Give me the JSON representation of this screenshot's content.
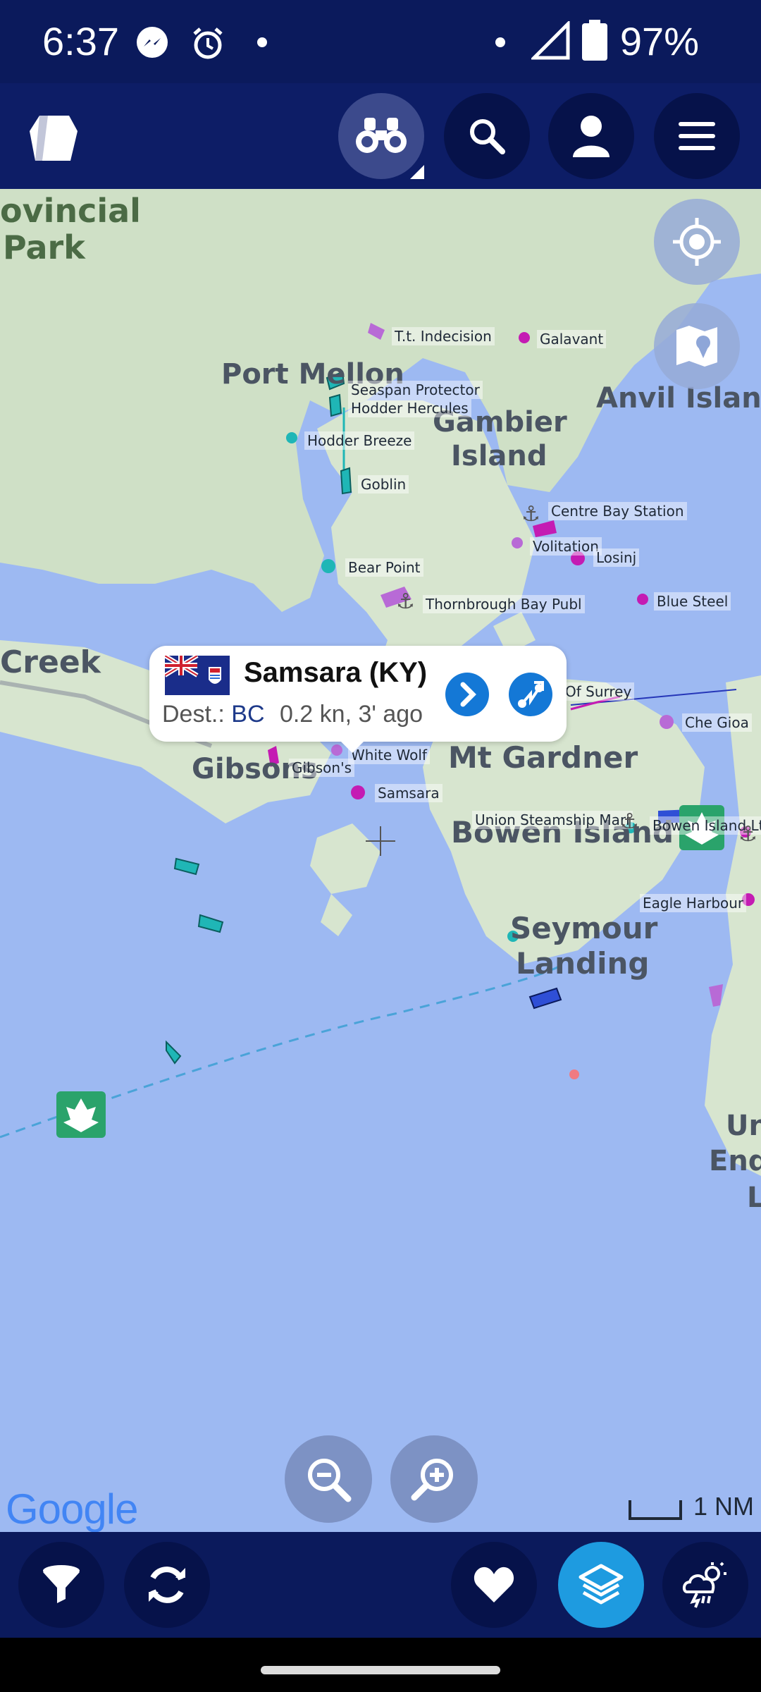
{
  "status": {
    "time": "6:37",
    "battery": "97%"
  },
  "popup": {
    "name": "Samsara (KY)",
    "dest_label": "Dest.:",
    "dest_value": "BC",
    "info": "0.2 kn, 3' ago"
  },
  "map": {
    "places": {
      "provincial": "ovincial",
      "park": "Park",
      "port_mellon": "Port Mellon",
      "gambier1": "Gambier",
      "gambier2": "Island",
      "anvil": "Anvil Island",
      "creek": "Creek",
      "gibsons": "Gibsons",
      "mt_gardner": "Mt Gardner",
      "bowen": "Bowen Island",
      "seymour1": "Seymour",
      "seymour2": "Landing",
      "un": "Un",
      "end": "End",
      "l": "L"
    },
    "vessels": [
      "T.t. Indecision",
      "Galavant",
      "Seaspan Protector",
      "Hodder Hercules",
      "Hodder Breeze",
      "Goblin",
      "Centre Bay Station",
      "Volitation",
      "Losinj",
      "Bear Point",
      "Thornbrough Bay Publ",
      "Blue Steel",
      "Of Surrey",
      "Che Gioa",
      "Gibson's",
      "White Wolf",
      "Samsara",
      "Union Steamship Mari",
      "Bowen Island Ltd",
      "Eagle Harbour"
    ],
    "google": "Google",
    "scale": "1 NM"
  },
  "icons": {
    "logo": "marinetraffic-logo-icon",
    "binoculars": "binoculars-icon",
    "search": "search-icon",
    "user": "user-icon",
    "menu": "menu-icon",
    "locate": "locate-icon",
    "maptype": "map-type-icon",
    "zoom_out": "zoom-out-icon",
    "zoom_in": "zoom-in-icon",
    "filter": "filter-icon",
    "refresh": "refresh-icon",
    "favorite": "heart-icon",
    "layers": "layers-icon",
    "weather": "weather-icon"
  },
  "colors": {
    "appbar": "#0d1d66",
    "water": "#9db9f2",
    "land": "#dde8d6",
    "accent": "#1e9be0",
    "vessel_teal": "#1fb6b6",
    "vessel_magenta": "#c41bb3"
  }
}
